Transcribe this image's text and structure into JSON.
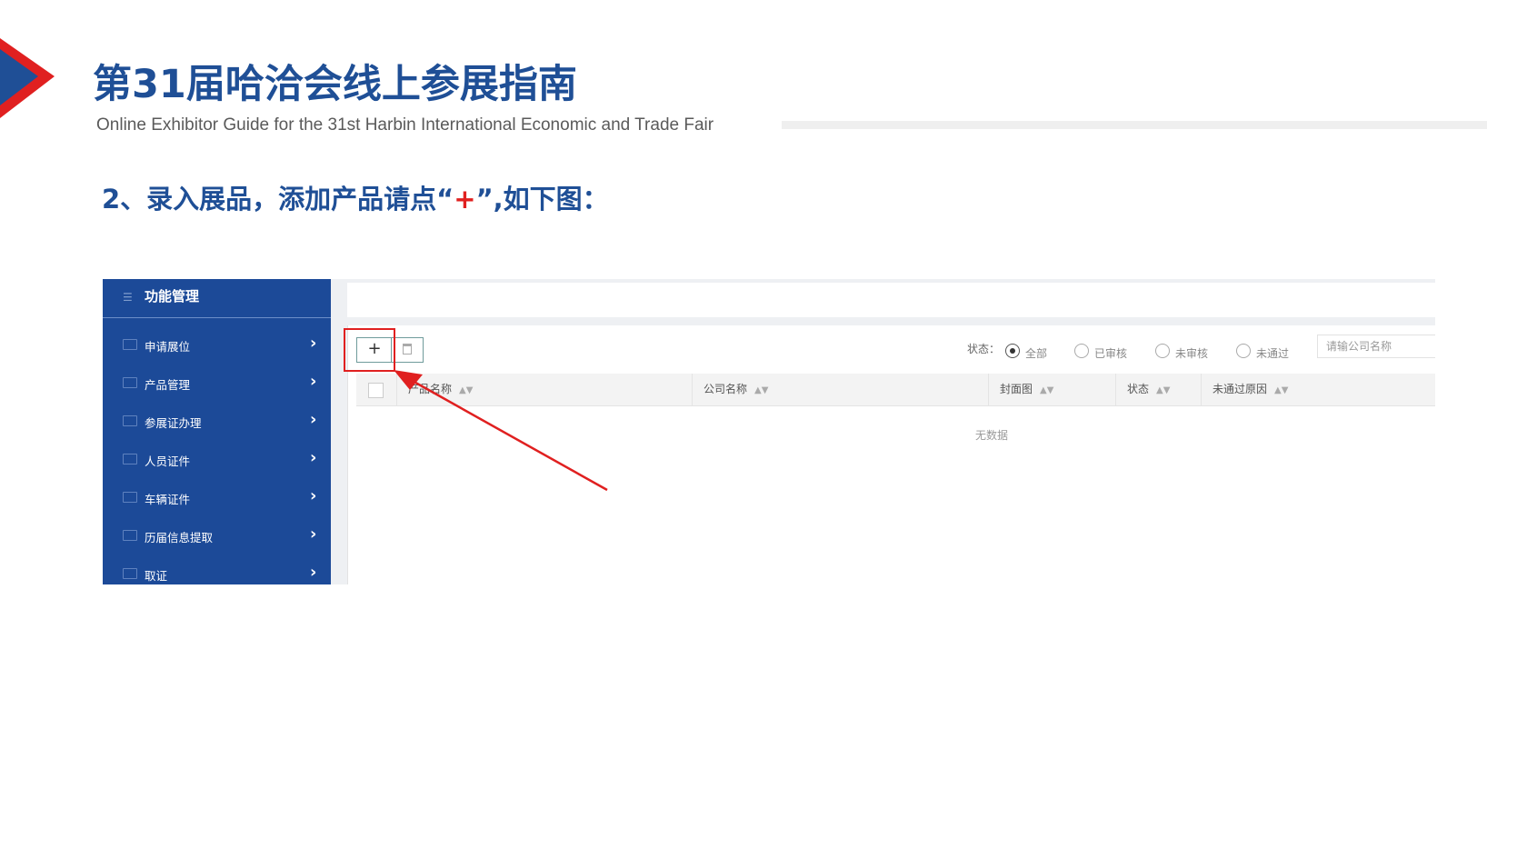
{
  "slide": {
    "title": "第31届哈洽会线上参展指南",
    "subtitle": "Online Exhibitor Guide for the 31st Harbin International Economic and Trade Fair",
    "step_prefix": "2、录入展品，添加产品请点“",
    "step_plus": "+",
    "step_suffix": "”,如下图："
  },
  "screenshot": {
    "sidebar": {
      "header": "功能管理",
      "items": [
        {
          "label": "申请展位",
          "icon": "monitor-icon"
        },
        {
          "label": "产品管理",
          "icon": "monitor-icon"
        },
        {
          "label": "参展证办理",
          "icon": "card-icon"
        },
        {
          "label": "人员证件",
          "icon": "id-card-icon"
        },
        {
          "label": "车辆证件",
          "icon": "car-icon"
        },
        {
          "label": "历届信息提取",
          "icon": "history-icon"
        },
        {
          "label": "取证",
          "icon": "card-icon"
        }
      ]
    },
    "toolbar": {
      "add_label": "+",
      "filter_label": "状态：",
      "status_options": [
        "全部",
        "已审核",
        "未审核",
        "未通过"
      ],
      "selected_status": "全部",
      "search_placeholder": "请输公司名称"
    },
    "table": {
      "columns": [
        "产品名称",
        "公司名称",
        "封面图",
        "状态",
        "未通过原因"
      ],
      "empty_text": "无数据"
    }
  },
  "colors": {
    "brand_blue": "#1f4f96",
    "sidebar_blue": "#1c4a98",
    "highlight_red": "#e02020"
  }
}
